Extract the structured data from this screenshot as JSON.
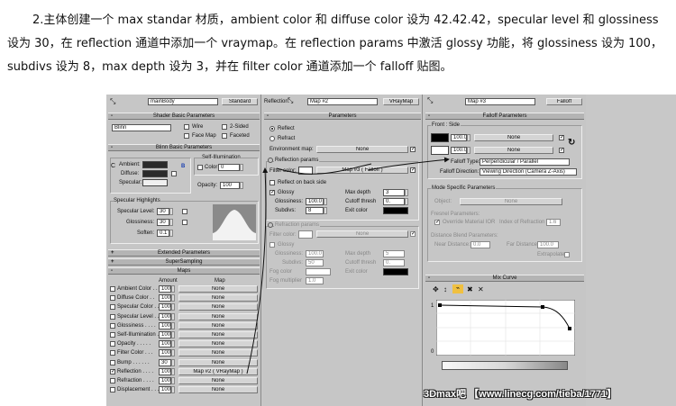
{
  "instructions": "2.主体创建一个 max standar 材质，ambient color 和 diffuse color 设为 42.42.42，specular level 和 glossiness 设为 30，在 reflection 通道中添加一个 vraymap。在 reflection params 中激活 glossy 功能，将 glossiness 设为 100，subdivs 设为 8，max depth 设为 3，并在 filter color 通道添加一个 falloff 贴图。",
  "panel1": {
    "material_name": "mainBody",
    "material_type": "Standard",
    "shader_header": "Shader Basic Parameters",
    "shader_value": "Blinn",
    "wire": "Wire",
    "two_sided": "2-Sided",
    "face_map": "Face Map",
    "faceted": "Faceted",
    "blinn_header": "Blinn Basic Parameters",
    "self_illum": "Self-Illumination",
    "ambient": "Ambient:",
    "diffuse": "Diffuse:",
    "specular": "Specular:",
    "color": "Color",
    "color_val": "0",
    "opacity": "Opacity:",
    "opacity_val": "100",
    "highlights": "Specular Highlights",
    "spec_level": "Specular Level:",
    "spec_level_val": "30",
    "glossiness": "Glossiness:",
    "glossiness_val": "30",
    "soften": "Soften:",
    "soften_val": "0.1",
    "ext_header": "Extended Parameters",
    "super_header": "SuperSampling",
    "maps_header": "Maps",
    "col_amount": "Amount",
    "col_map": "Map",
    "none": "None",
    "maps": [
      {
        "label": "Ambient Color . .",
        "amount": "100",
        "map": "None",
        "on": false
      },
      {
        "label": "Diffuse Color . .",
        "amount": "100",
        "map": "None",
        "on": false
      },
      {
        "label": "Specular Color . .",
        "amount": "100",
        "map": "None",
        "on": false
      },
      {
        "label": "Specular Level . .",
        "amount": "100",
        "map": "None",
        "on": false
      },
      {
        "label": "Glossiness . . . .",
        "amount": "100",
        "map": "None",
        "on": false
      },
      {
        "label": "Self-Illumination .",
        "amount": "100",
        "map": "None",
        "on": false
      },
      {
        "label": "Opacity . . . . .",
        "amount": "100",
        "map": "None",
        "on": false
      },
      {
        "label": "Filter Color . . .",
        "amount": "100",
        "map": "None",
        "on": false
      },
      {
        "label": "Bump . . . . . .",
        "amount": "30",
        "map": "None",
        "on": false
      },
      {
        "label": "Reflection . . . .",
        "amount": "100",
        "map": "Map #2  ( VRayMap )",
        "on": true
      },
      {
        "label": "Refraction . . . .",
        "amount": "100",
        "map": "None",
        "on": false
      },
      {
        "label": "Displacement . . .",
        "amount": "100",
        "map": "None",
        "on": false
      }
    ]
  },
  "panel2": {
    "slot_label": "Reflection:",
    "map_name": "Map #2",
    "map_type": "VRayMap",
    "params_header": "Parameters",
    "reflect": "Reflect",
    "refract": "Refract",
    "env_map": "Environment map:",
    "none": "None",
    "refl_params": "Reflection params",
    "filter_color": "Filter color:",
    "filter_map": "Map #3  ( Falloff )",
    "reflect_back": "Reflect on back side",
    "glossy": "Glossy",
    "glossiness": "Glossiness:",
    "glossiness_val": "100.0",
    "subdivs": "Subdivs:",
    "subdivs_val": "8",
    "max_depth": "Max depth",
    "max_depth_val": "3",
    "cutoff": "Cutoff thresh",
    "cutoff_val": "0.",
    "exit_color": "Exit color",
    "refr_params": "Refraction params",
    "refr_filter": "Filter color:",
    "refr_glossy": "Glossy",
    "refr_glossiness": "Glossiness:",
    "refr_glossiness_val": "100.0",
    "refr_subdivs": "Subdivs:",
    "refr_subdivs_val": "50",
    "refr_max_depth": "Max depth",
    "refr_max_depth_val": "5",
    "refr_cutoff": "Cutoff thresh",
    "refr_cutoff_val": "0.",
    "fog_color": "Fog color",
    "fog_mult": "Fog multiplier",
    "fog_mult_val": "1.0",
    "exit_color2": "Exit color"
  },
  "panel3": {
    "map_name": "Map #3",
    "map_type": "Falloff",
    "falloff_header": "Falloff Parameters",
    "front_side": "Front : Side",
    "val1": "100.0",
    "val2": "100.0",
    "none": "None",
    "falloff_type_label": "Falloff Type:",
    "falloff_type": "Perpendicular / Parallel",
    "falloff_dir_label": "Falloff Direction:",
    "falloff_dir": "Viewing Direction (Camera Z-Axis)",
    "mode_header": "Mode Specific Parameters",
    "object": "Object:",
    "fresnel": "Fresnel Parameters:",
    "override_ior": "Override Material IOR",
    "ior_label": "Index of Refraction",
    "ior_val": "1.6",
    "distance_blend": "Distance Blend Parameters:",
    "near": "Near Distance:",
    "near_val": "0.0",
    "far": "Far Distance:",
    "far_val": "100.0",
    "extrapolate": "Extrapolate",
    "mix_header": "Mix Curve",
    "curve_top": "1",
    "curve_bottom": "0"
  },
  "watermark": "3Dmax吧 【www.linecg.com/tieba/1771】",
  "colors": {
    "panel_bg": "#c6c6c6",
    "header_bg": "#b4b4b4",
    "dark_swatch": "#2a2a2a",
    "black_swatch": "#000000",
    "arrow": "#111111"
  }
}
